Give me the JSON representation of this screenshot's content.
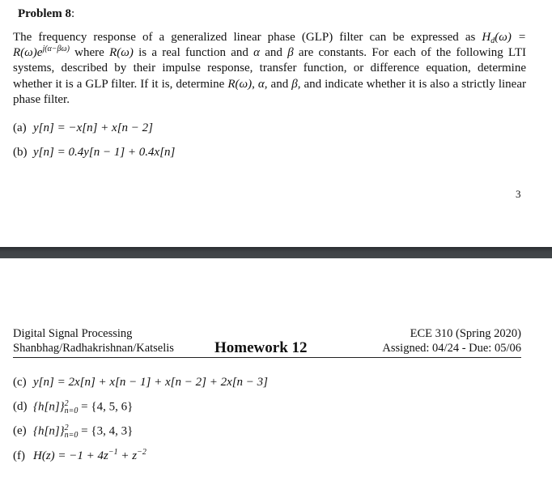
{
  "page_top": {
    "problem_title": "Problem 8",
    "problem_colon": ":",
    "intro": {
      "t1": "The frequency response of a generalized linear phase (GLP) filter can be expressed as ",
      "Hd": "H",
      "Hd_sub": "d",
      "Hd_arg": "(ω) =",
      "R1": "R",
      "R1_arg": "(ω)",
      "e": "e",
      "e_exp": "j(α−βω)",
      "t2": " where ",
      "R2": "R",
      "R2_arg": "(ω)",
      "t3": " is a real function and ",
      "alpha": "α",
      "t4": " and ",
      "beta": "β",
      "t5": " are constants. For each of the following LTI systems, described by their impulse response, transfer function, or difference equation, determine whether it is a GLP filter. If it is, determine ",
      "R3": "R",
      "R3_arg": "(ω)",
      "t6": ", ",
      "alpha2": "α",
      "t7": ", and ",
      "beta2": "β",
      "t8": ", and indicate whether it is also a strictly linear phase filter."
    },
    "items": [
      {
        "label": "(a)",
        "equation": "y[n] = −x[n] + x[n − 2]"
      },
      {
        "label": "(b)",
        "equation": "y[n] = 0.4y[n − 1] + 0.4x[n]"
      }
    ],
    "page_number": "3"
  },
  "page_bottom": {
    "header": {
      "course_name": "Digital Signal Processing",
      "instructors": "Shanbhag/Radhakrishnan/Katselis",
      "title": "Homework 12",
      "course_code": "ECE 310 (Spring 2020)",
      "dates": "Assigned: 04/24 - Due: 05/06"
    },
    "items": [
      {
        "label": "(c)",
        "equation": "y[n] = 2x[n] + x[n − 1] + x[n − 2] + 2x[n − 3]"
      },
      {
        "label": "(d)",
        "pre": "{h[n]}",
        "sup": "2",
        "sub": "n=0",
        "post": " = {4, 5, 6}"
      },
      {
        "label": "(e)",
        "pre": "{h[n]}",
        "sup": "2",
        "sub": "n=0",
        "post": " = {3, 4, 3}"
      },
      {
        "label": "(f)",
        "pre": "H(z) = −1 + 4z",
        "sup1": "−1",
        "mid": " + z",
        "sup2": "−2"
      }
    ]
  },
  "colors": {
    "separator": "#3e4245",
    "text": "#111111",
    "background": "#ffffff"
  }
}
